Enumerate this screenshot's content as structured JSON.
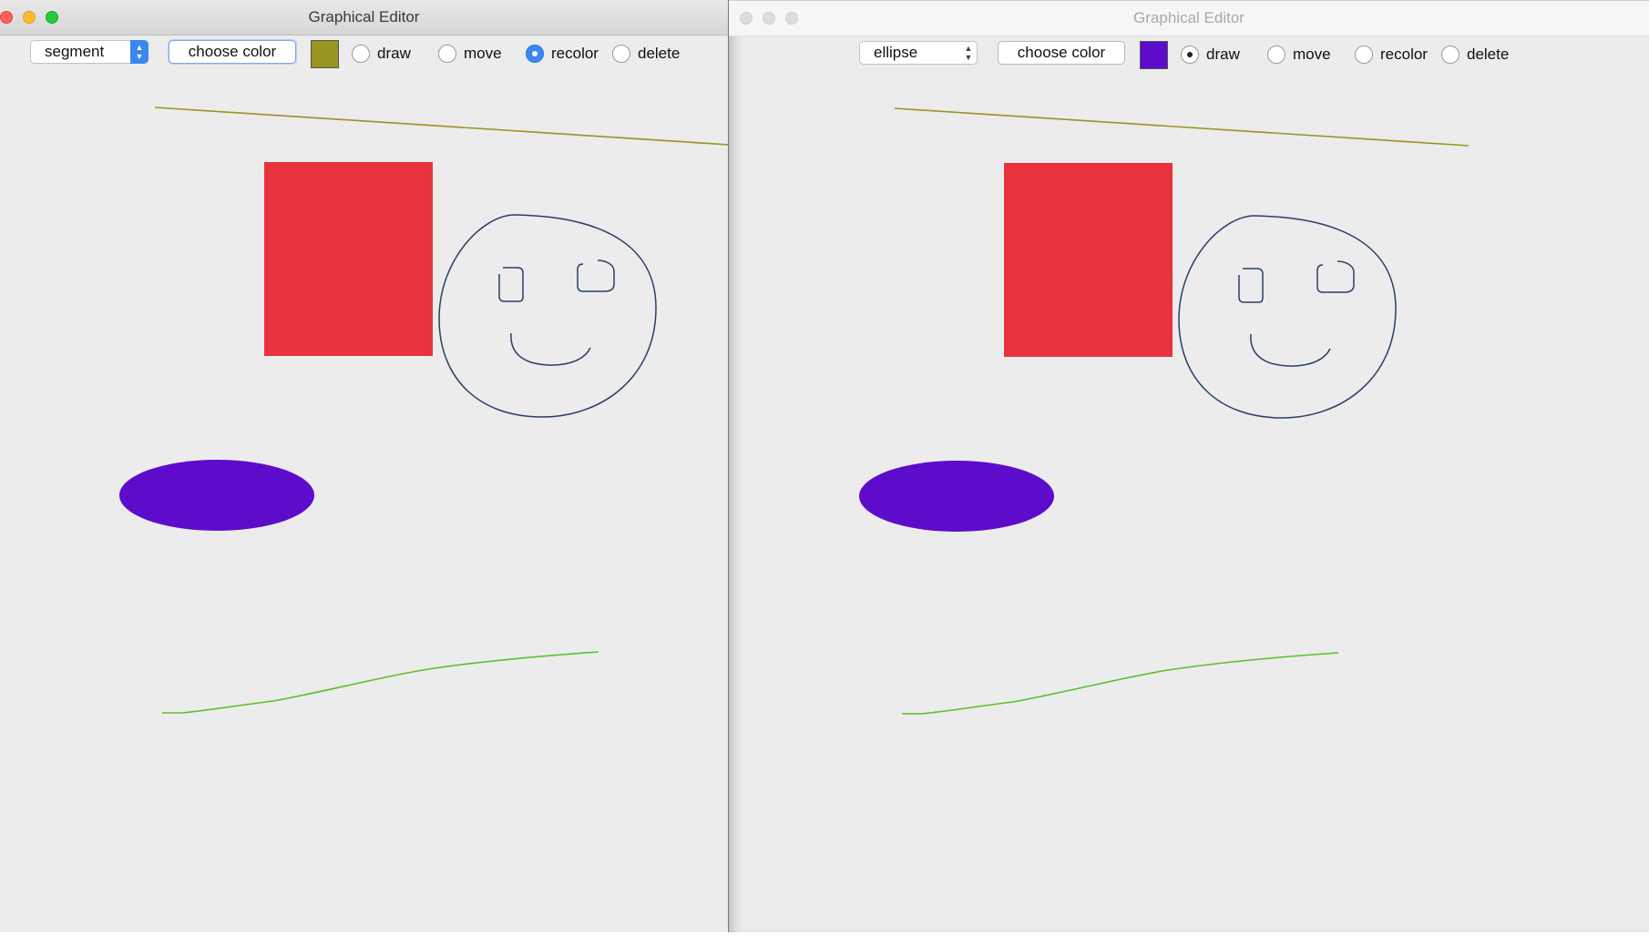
{
  "windows": [
    {
      "title": "Graphical Editor",
      "active": true,
      "shape_select": "segment",
      "choose_color_label": "choose color",
      "current_color": "#9a9420",
      "modes": [
        {
          "label": "draw",
          "selected": false
        },
        {
          "label": "move",
          "selected": false
        },
        {
          "label": "recolor",
          "selected": true
        },
        {
          "label": "delete",
          "selected": false
        }
      ]
    },
    {
      "title": "Graphical Editor",
      "active": false,
      "shape_select": "ellipse",
      "choose_color_label": "choose color",
      "current_color": "#5e0ccc",
      "modes": [
        {
          "label": "draw",
          "selected": true
        },
        {
          "label": "move",
          "selected": false
        },
        {
          "label": "recolor",
          "selected": false
        },
        {
          "label": "delete",
          "selected": false
        }
      ]
    }
  ],
  "drawing": {
    "segment_color": "#9a9420",
    "rectangle_color": "#e8333e",
    "face_stroke_color": "#2b3e66",
    "ellipse_color": "#5e0ccc",
    "freehand_green_color": "#5bbf2a"
  }
}
